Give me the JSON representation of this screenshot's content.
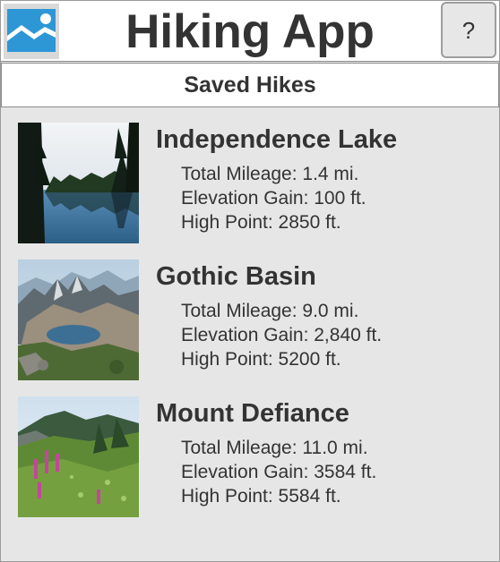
{
  "app": {
    "title": "Hiking App",
    "help_label": "?",
    "logo_icon": "image-placeholder-icon"
  },
  "section": {
    "title": "Saved Hikes"
  },
  "hikes": [
    {
      "name": "Independence Lake",
      "image": "lake-forest-photo",
      "mileage": "Total Mileage: 1.4 mi.",
      "elevation": "Elevation Gain: 100 ft.",
      "high_point": "High Point: 2850 ft."
    },
    {
      "name": "Gothic Basin",
      "image": "mountain-basin-photo",
      "mileage": "Total Mileage: 9.0 mi.",
      "elevation": "Elevation Gain: 2,840 ft.",
      "high_point": "High Point: 5200 ft."
    },
    {
      "name": "Mount Defiance",
      "image": "wildflower-meadow-photo",
      "mileage": "Total Mileage: 11.0 mi.",
      "elevation": "Elevation Gain: 3584 ft.",
      "high_point": "High Point: 5584 ft."
    }
  ],
  "colors": {
    "background": "#e6e6e6",
    "bar": "#ffffff",
    "text": "#333333",
    "logo_blue": "#2d97d6"
  }
}
